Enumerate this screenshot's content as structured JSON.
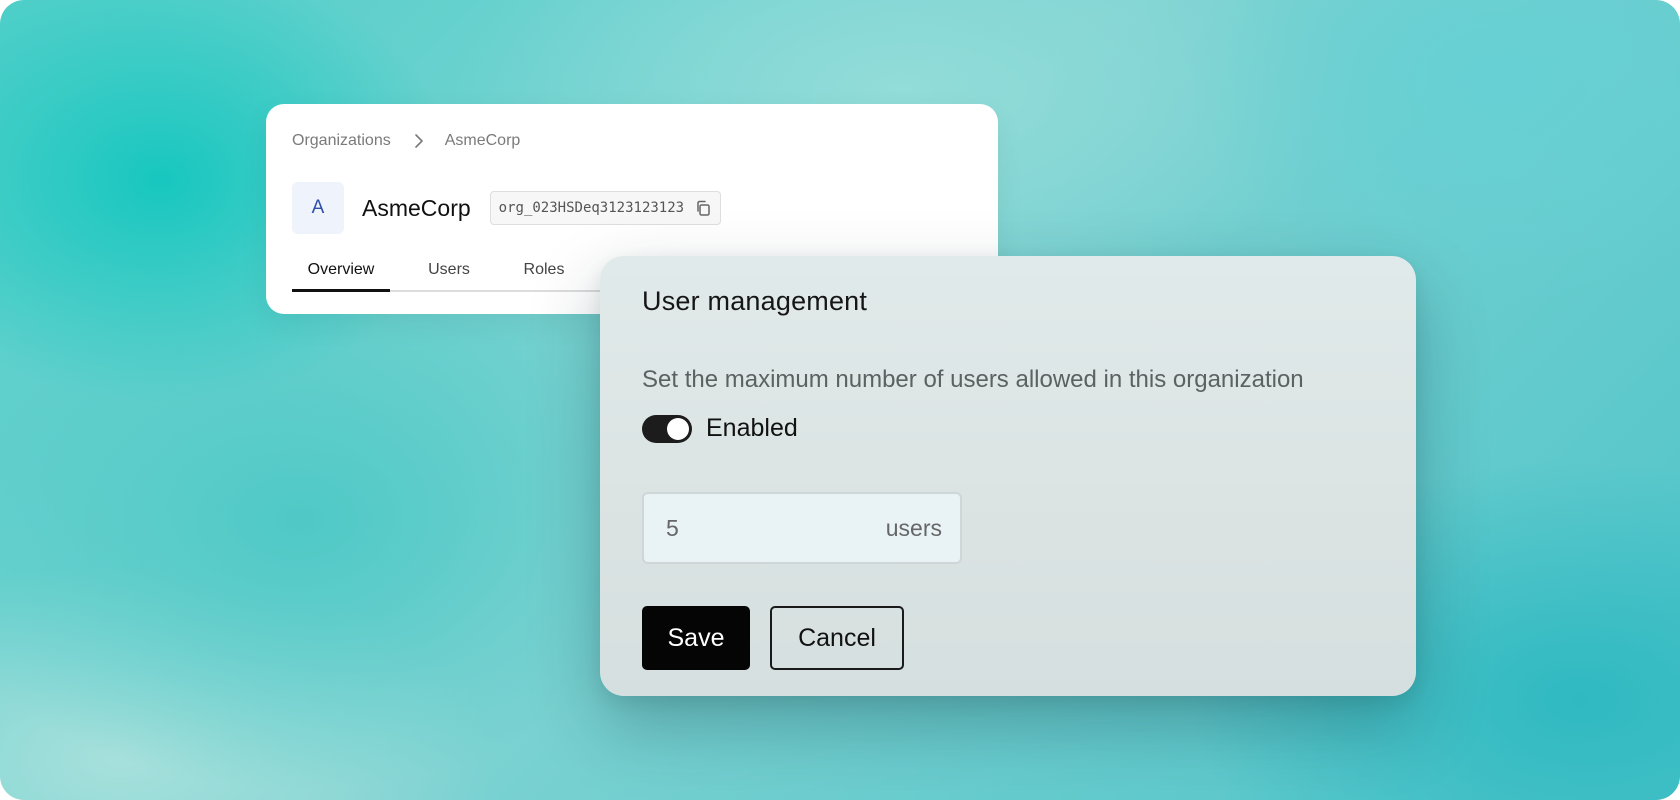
{
  "colors": {
    "accent": "#050505",
    "avatar_text": "#2f4fa8",
    "avatar_bg": "#eef3fc"
  },
  "org_card": {
    "breadcrumb": [
      {
        "label": "Organizations"
      },
      {
        "label": "AsmeCorp"
      }
    ],
    "breadcrumb_separator_icon": "chevron-right-icon",
    "avatar_letter": "A",
    "name": "AsmeCorp",
    "org_id": "org_023HSDeq3123123123",
    "copy_icon": "copy-icon",
    "tabs": [
      {
        "label": "Overview",
        "active": true
      },
      {
        "label": "Users",
        "active": false
      },
      {
        "label": "Roles",
        "active": false
      }
    ]
  },
  "modal": {
    "title": "User management",
    "description": "Set the maximum number of users allowed in this organization",
    "toggle": {
      "label": "Enabled",
      "on": true
    },
    "max_users": {
      "value": "5",
      "unit": "users"
    },
    "save_label": "Save",
    "cancel_label": "Cancel"
  }
}
